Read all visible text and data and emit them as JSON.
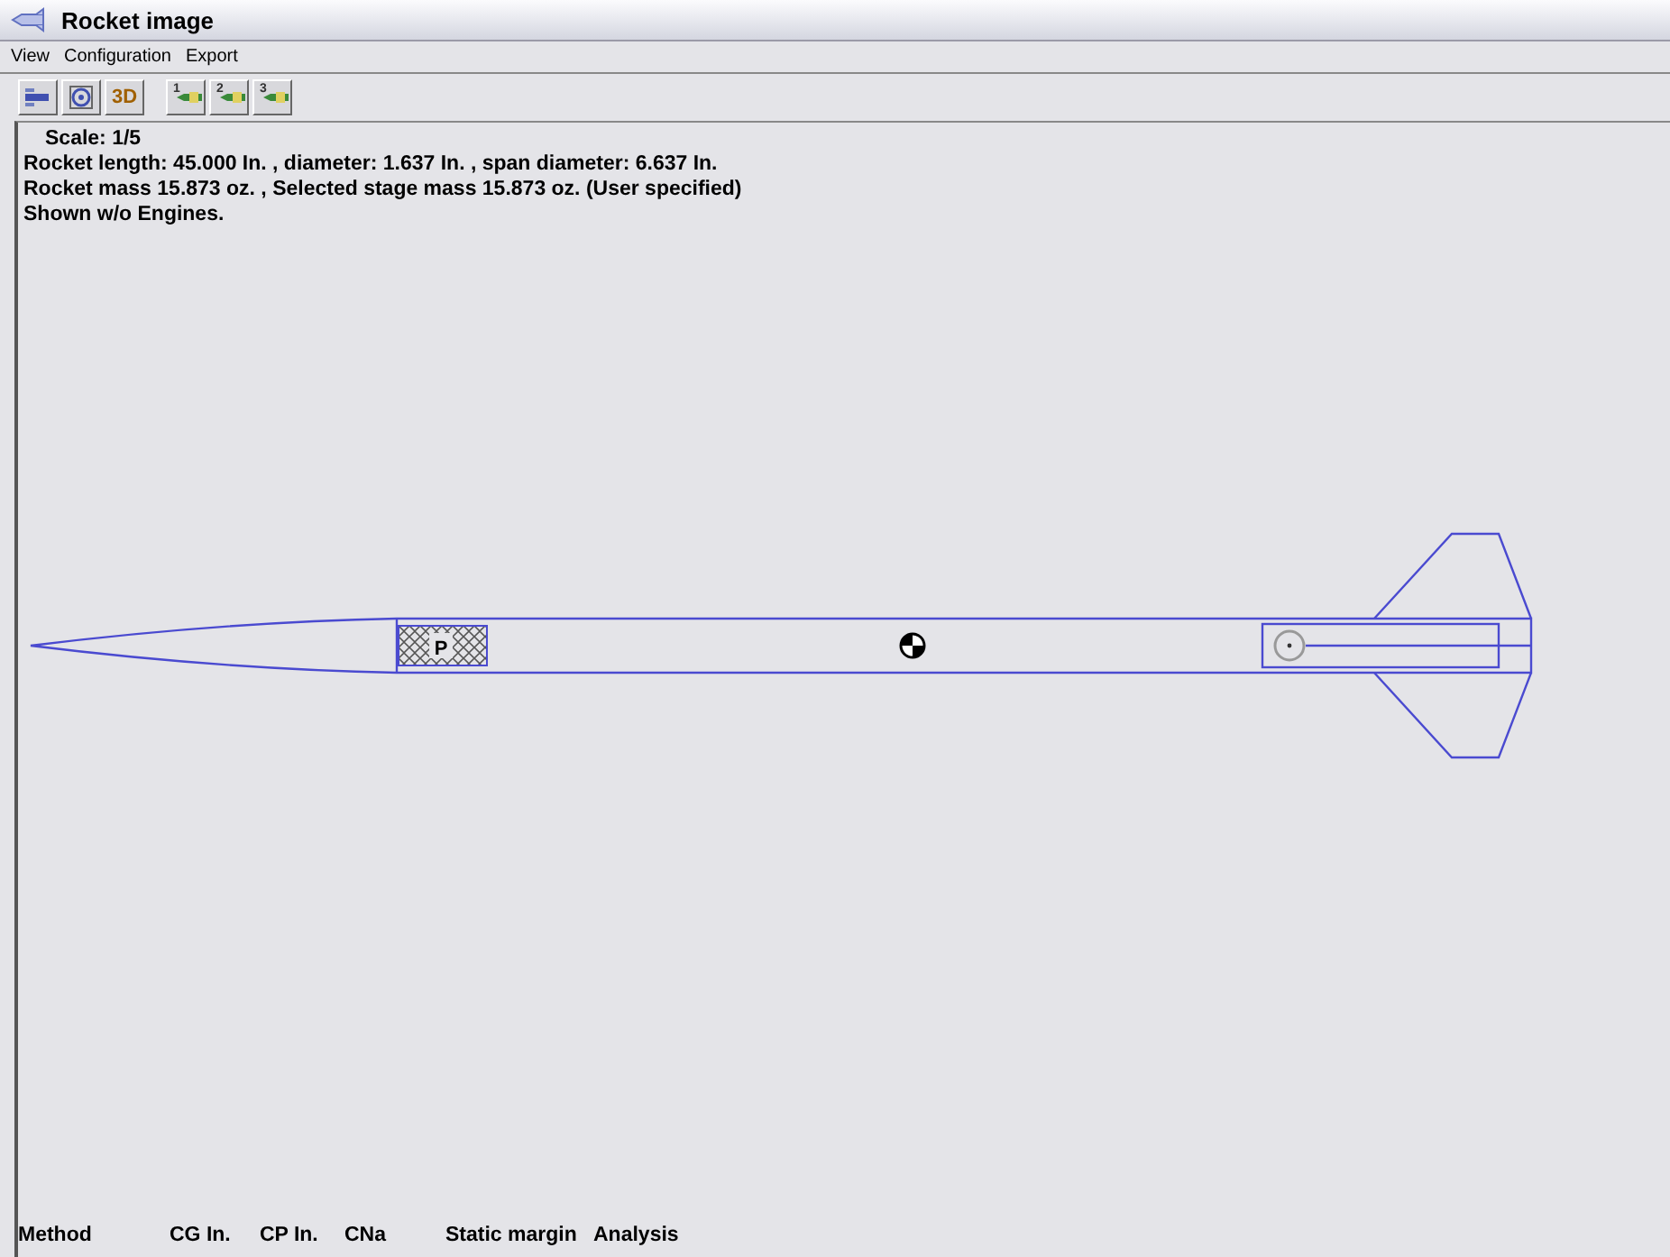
{
  "window": {
    "title": "Rocket image"
  },
  "menu": [
    "View",
    "Configuration",
    "Export"
  ],
  "toolbar": [
    {
      "kind": "side"
    },
    {
      "kind": "end"
    },
    {
      "kind": "text",
      "label": "3D"
    },
    {
      "kind": "stage",
      "label": "1"
    },
    {
      "kind": "stage",
      "label": "2"
    },
    {
      "kind": "stage",
      "label": "3"
    }
  ],
  "info": [
    "Scale: 1/5",
    "Rocket length: 45.000  In. , diameter: 1.637  In. , span diameter: 6.637  In.",
    "Rocket mass 15.873 oz. , Selected stage mass 15.873 oz. (User specified)",
    "Shown w/o Engines."
  ],
  "drawing": {
    "payload_label": "P"
  },
  "results": {
    "columns": [
      "Method",
      "CG In.",
      "CP In.",
      "CNa",
      "Static margin",
      "Analysis"
    ]
  }
}
